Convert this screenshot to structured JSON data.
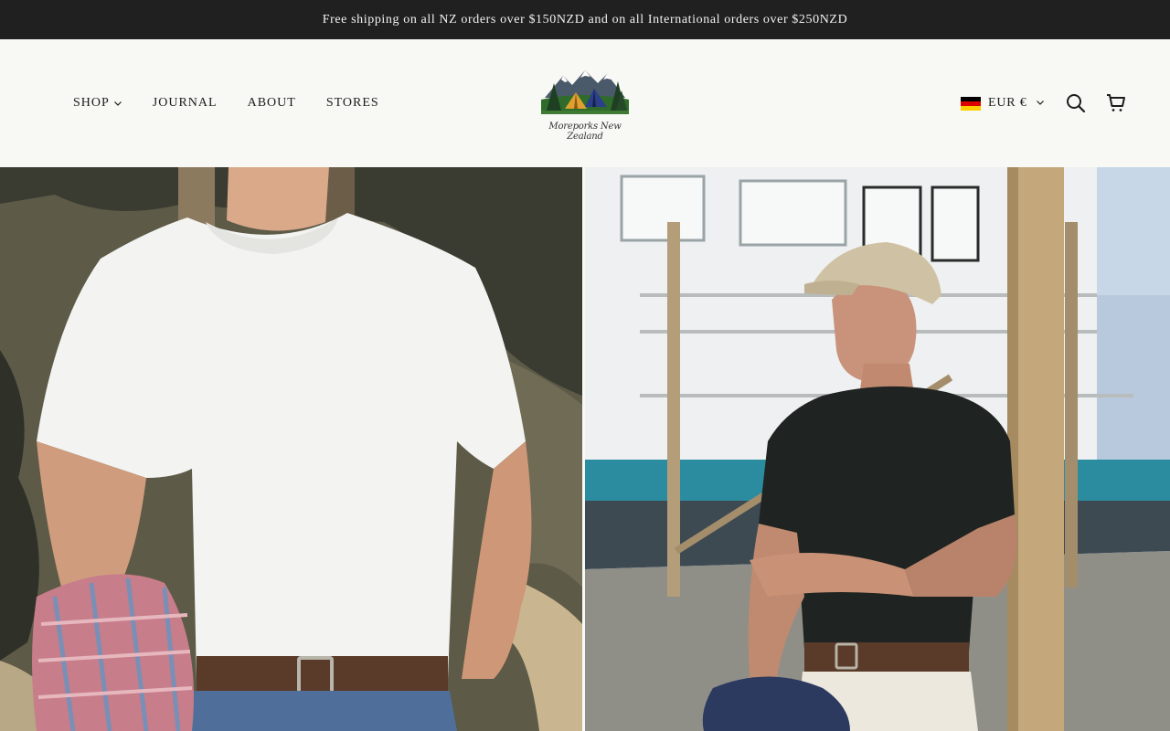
{
  "announcement": {
    "text": "Free shipping on all NZ orders over $150NZD and on all International orders over $250NZD"
  },
  "nav": {
    "items": [
      {
        "label": "SHOP",
        "has_dropdown": true
      },
      {
        "label": "JOURNAL",
        "has_dropdown": false
      },
      {
        "label": "ABOUT",
        "has_dropdown": false
      },
      {
        "label": "STORES",
        "has_dropdown": false
      }
    ]
  },
  "logo": {
    "text": "Moreporks New Zealand"
  },
  "currency": {
    "label": "EUR €",
    "flag": "germany-flag",
    "flag_colors": [
      "#000000",
      "#dd0000",
      "#ffce00"
    ]
  },
  "icons": {
    "search": "search-icon",
    "cart": "cart-icon"
  },
  "hero": {
    "left_image": "man in white t-shirt with flannel shirt",
    "right_image": "man in black t-shirt and cap near boat"
  },
  "colors": {
    "announcement_bg": "#202020",
    "header_bg": "#f8f9f5",
    "text": "#1c1c1c"
  }
}
